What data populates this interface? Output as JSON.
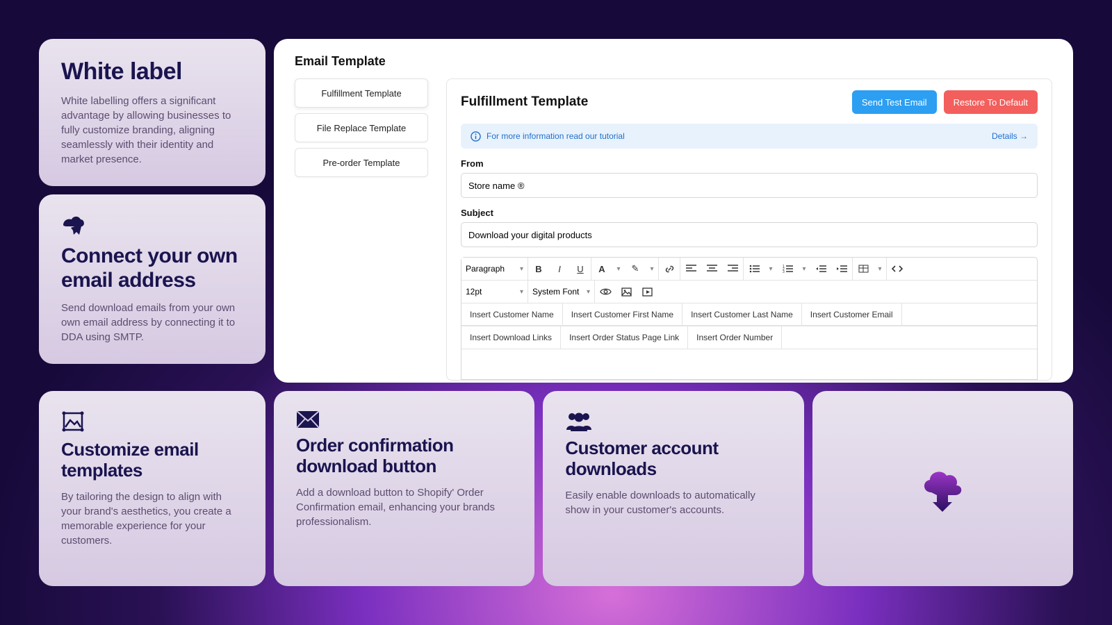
{
  "cards": {
    "white_label": {
      "title": "White label",
      "body": "White labelling offers a significant advantage by allowing businesses to fully customize branding, aligning seamlessly with their identity and market presence."
    },
    "connect_email": {
      "title": "Connect your own email address",
      "body": "Send download emails from your own own email address by connecting it to DDA using SMTP."
    },
    "customize_templates": {
      "title": "Customize email templates",
      "body": "By tailoring the design to align with your brand's aesthetics, you create a memorable experience for your customers."
    },
    "order_confirmation": {
      "title": "Order confirmation download button",
      "body": "Add a download button to Shopify' Order Confirmation email, enhancing your brands professionalism."
    },
    "customer_account": {
      "title": "Customer account downloads",
      "body": "Easily enable downloads to automatically show in your customer's accounts."
    }
  },
  "editor": {
    "panel_title": "Email Template",
    "templates": [
      "Fulfillment Template",
      "File Replace Template",
      "Pre-order Template"
    ],
    "main_title": "Fulfillment Template",
    "send_test": "Send Test Email",
    "restore": "Restore To Default",
    "info_text": "For more information read our tutorial",
    "details": "Details →",
    "from_label": "From",
    "from_value": "Store name ®",
    "subject_label": "Subject",
    "subject_value": "Download your digital products",
    "toolbar": {
      "block": "Paragraph",
      "font_size": "12pt",
      "font_family": "System Font"
    },
    "inserts": [
      "Insert Customer Name",
      "Insert Customer First Name",
      "Insert Customer Last Name",
      "Insert Customer Email",
      "Insert Download Links",
      "Insert Order Status Page Link",
      "Insert Order Number"
    ]
  }
}
